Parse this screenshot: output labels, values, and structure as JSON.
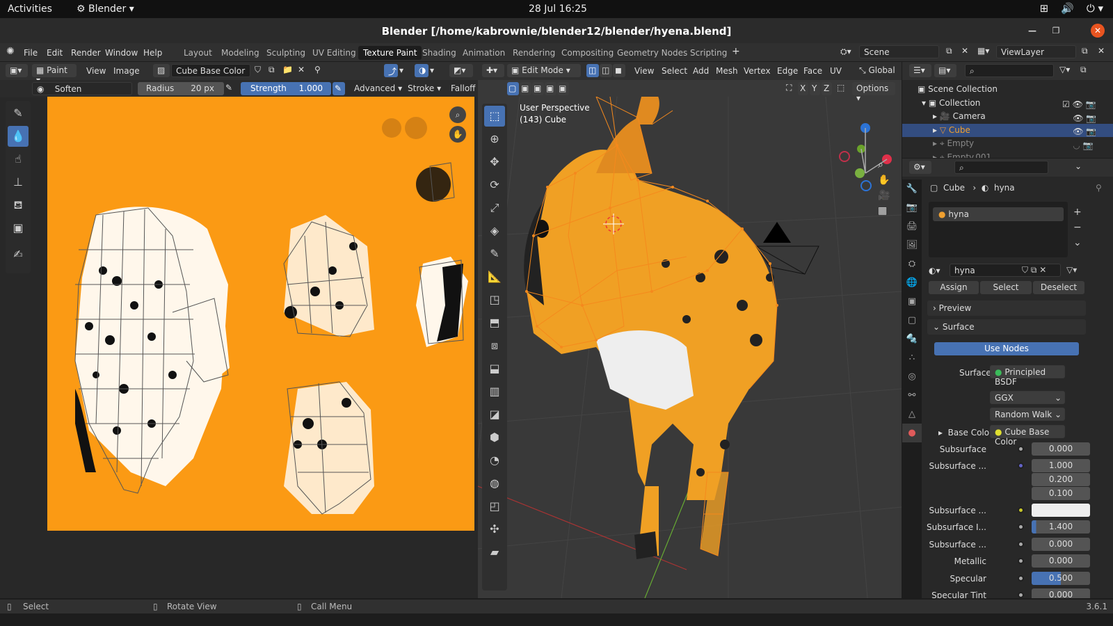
{
  "gnome": {
    "activities": "Activities",
    "app": "Blender",
    "clock": "28 Jul  16:25"
  },
  "window": {
    "title": "Blender [/home/kabrownie/blender12/blender/hyena.blend]"
  },
  "menus": [
    "File",
    "Edit",
    "Render",
    "Window",
    "Help"
  ],
  "workspaces": [
    "Layout",
    "Modeling",
    "Sculpting",
    "UV Editing",
    "Texture Paint",
    "Shading",
    "Animation",
    "Rendering",
    "Compositing",
    "Geometry Nodes",
    "Scripting"
  ],
  "active_workspace": "Texture Paint",
  "scene": "Scene",
  "view_layer": "ViewLayer",
  "image_editor": {
    "mode": "Paint",
    "view": "View",
    "image": "Image",
    "image_name": "Cube Base Color",
    "brush": "Soften",
    "radius_label": "Radius",
    "radius_value": "20 px",
    "strength_label": "Strength",
    "strength_value": "1.000",
    "advanced": "Advanced",
    "stroke": "Stroke",
    "falloff": "Falloff"
  },
  "viewport": {
    "mode": "Edit Mode",
    "menus": [
      "View",
      "Select",
      "Add",
      "Mesh",
      "Vertex",
      "Edge",
      "Face",
      "UV"
    ],
    "orientation": "Global",
    "options": "Options",
    "persp": "User Perspective",
    "object_info": "(143) Cube",
    "axes": [
      "X",
      "Y",
      "Z"
    ]
  },
  "outliner": {
    "scene_collection": "Scene Collection",
    "items": [
      {
        "label": "Collection"
      },
      {
        "label": "Camera"
      },
      {
        "label": "Cube"
      },
      {
        "label": "Empty"
      },
      {
        "label": "Empty.001"
      }
    ]
  },
  "properties": {
    "breadcrumb_object": "Cube",
    "breadcrumb_material": "hyna",
    "slot": "hyna",
    "material_name": "hyna",
    "assign": "Assign",
    "select": "Select",
    "deselect": "Deselect",
    "preview": "Preview",
    "surface_panel": "Surface",
    "use_nodes": "Use Nodes",
    "surface_label": "Surface",
    "surface_value": "Principled BSDF",
    "distribution": "GGX",
    "subsurface_method": "Random Walk",
    "base_color_label": "Base Color",
    "base_color_value": "Cube Base Color",
    "rows": [
      {
        "label": "Subsurface",
        "value": "0.000",
        "dot": "#999999"
      },
      {
        "label": "Subsurface ...",
        "value": "1.000",
        "dot": "#6363c7"
      },
      {
        "label": "",
        "value": "0.200",
        "dot": ""
      },
      {
        "label": "",
        "value": "0.100",
        "dot": ""
      },
      {
        "label": "Subsurface ...",
        "value": "",
        "dot": "#c7c729"
      },
      {
        "label": "Subsurface I...",
        "value": "1.400",
        "dot": "#999999"
      },
      {
        "label": "Subsurface ...",
        "value": "0.000",
        "dot": "#999999"
      },
      {
        "label": "Metallic",
        "value": "0.000",
        "dot": "#999999"
      },
      {
        "label": "Specular",
        "value": "0.500",
        "dot": "#999999"
      },
      {
        "label": "Specular Tint",
        "value": "0.000",
        "dot": "#999999"
      }
    ]
  },
  "status": {
    "select": "Select",
    "rotate": "Rotate View",
    "call_menu": "Call Menu",
    "version": "3.6.1"
  },
  "colors": {
    "accent": "#4772b3",
    "texture_bg": "#fb9a14",
    "edit_orange": "#f5891d"
  }
}
